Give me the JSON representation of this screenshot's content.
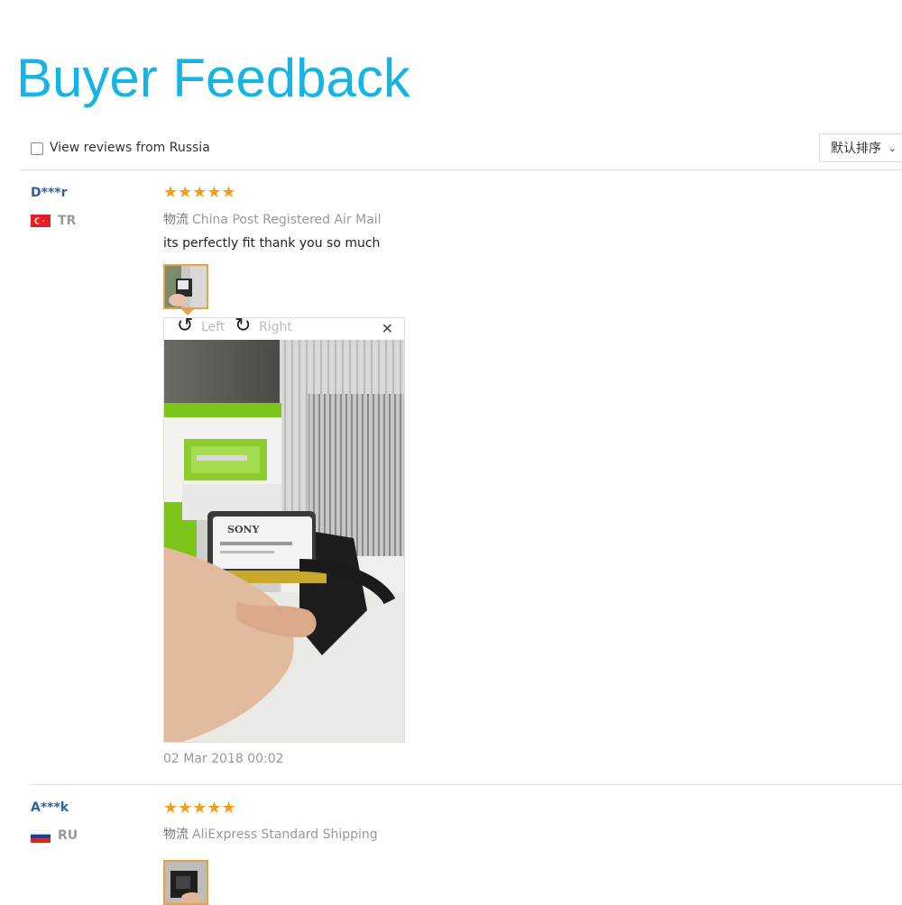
{
  "page": {
    "title": "Buyer Feedback"
  },
  "filters": {
    "russia_checkbox_label": "View reviews from Russia",
    "russia_checked": false,
    "sort_label": "默认排序",
    "sort_chevron": "⌄"
  },
  "reviews": [
    {
      "user": "D***r",
      "country": "TR",
      "stars": "★★★★★",
      "rating": 5,
      "shipping_label": "物流",
      "shipping": "China Post Registered Air Mail",
      "comment": "its perfectly fit thank you so much",
      "viewer": {
        "rotate_left": "Left",
        "rotate_right": "Right",
        "close": "✕"
      },
      "brand_text": "SONY",
      "date": "02 Mar 2018 00:02"
    },
    {
      "user": "A***k",
      "country": "RU",
      "stars": "★★★★★",
      "rating": 5,
      "shipping_label": "物流",
      "shipping": "AliExpress Standard Shipping"
    }
  ],
  "colors": {
    "title": "#15b4e6",
    "username": "#2d5fa4",
    "stars": "#f59c1a",
    "thumb_border": "#e6a14a"
  }
}
